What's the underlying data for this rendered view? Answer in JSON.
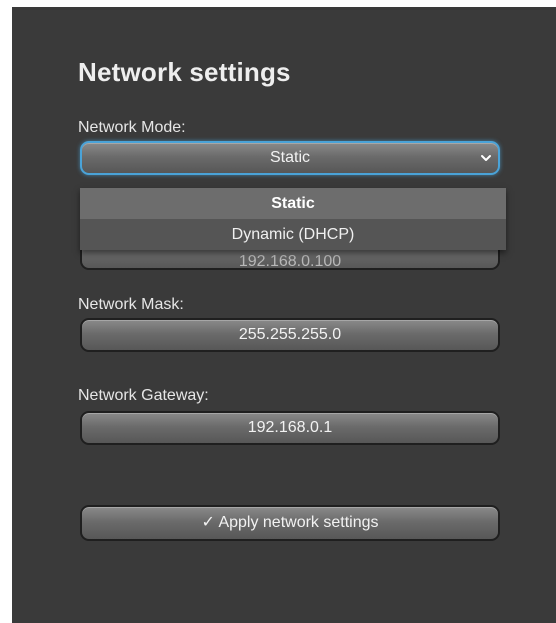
{
  "title": "Network settings",
  "network_mode": {
    "label": "Network Mode:",
    "value": "Static",
    "options": [
      "Static",
      "Dynamic (DHCP)"
    ],
    "selected_index": 0
  },
  "ip_address": {
    "value": "192.168.0.100"
  },
  "network_mask": {
    "label": "Network Mask:",
    "value": "255.255.255.0"
  },
  "network_gateway": {
    "label": "Network Gateway:",
    "value": "192.168.0.1"
  },
  "apply_button": {
    "label": "✓ Apply network settings"
  },
  "colors": {
    "panel_bg": "#3a3a3a",
    "focus_ring": "#4aa3d8"
  },
  "icons": {
    "select_arrow": "chevron-down-icon"
  }
}
